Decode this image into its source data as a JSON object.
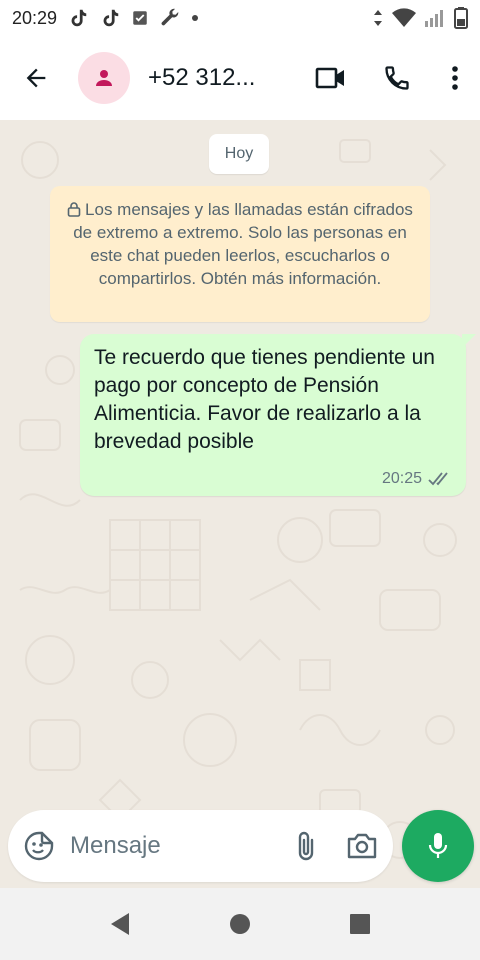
{
  "status_bar": {
    "time": "20:29",
    "notification_icons": [
      "tiktok-icon",
      "tiktok-icon",
      "checkbox-icon",
      "wrench-icon",
      "dot-icon"
    ],
    "system_icons": [
      "data-arrows-icon",
      "wifi-icon",
      "signal-icon",
      "battery-icon"
    ]
  },
  "app_bar": {
    "contact_name": "+52 312...",
    "icons": [
      "back-arrow-icon",
      "avatar-person-icon",
      "video-call-icon",
      "voice-call-icon",
      "more-options-icon"
    ]
  },
  "chat": {
    "date_chip": "Hoy",
    "encryption_notice": "Los mensajes y las llamadas están cifrados de extremo a extremo. Solo las personas en este chat pueden leerlos, escucharlos o compartirlos. Obtén más información.",
    "messages": [
      {
        "direction": "outgoing",
        "text": "Te recuerdo que tienes pendiente un pago por concepto de Pensión Alimenticia. Favor de realizarlo a la brevedad posible",
        "time": "20:25",
        "status": "delivered"
      }
    ]
  },
  "composer": {
    "placeholder": "Mensaje",
    "value": "",
    "icons": [
      "sticker-emoji-icon",
      "paperclip-icon",
      "camera-icon",
      "microphone-icon"
    ]
  },
  "colors": {
    "chat_background": "#efeae2",
    "outgoing_bubble": "#d9fdd3",
    "notice_background": "#ffeecd",
    "avatar_background": "#fbdde4",
    "avatar_icon": "#c2185b",
    "mic_button": "#1daa61",
    "read_ticks": "#667781"
  },
  "nav_bar": {
    "icons": [
      "back-triangle-icon",
      "home-circle-icon",
      "recents-square-icon"
    ]
  }
}
